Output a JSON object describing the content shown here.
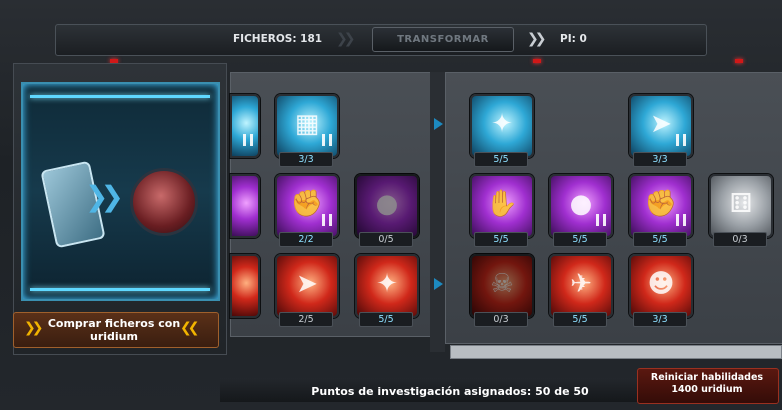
{
  "header": {
    "ficheros": "FICHEROS: 181",
    "transform_label": "TRANSFORMAR",
    "pi": "PI: 0"
  },
  "left_panel": {
    "buy_button": "Comprar ficheros con uridium"
  },
  "skills": [
    {
      "level": "",
      "color": "cyan"
    },
    {
      "level": "3/3",
      "color": "cyan"
    },
    {
      "level": "5/5",
      "color": "cyan"
    },
    {
      "level": "3/3",
      "color": "cyan"
    },
    {
      "level": "",
      "color": "purple"
    },
    {
      "level": "2/2",
      "color": "purple"
    },
    {
      "level": "0/5",
      "color": "purple"
    },
    {
      "level": "5/5",
      "color": "purple"
    },
    {
      "level": "5/5",
      "color": "purple"
    },
    {
      "level": "5/5",
      "color": "purple"
    },
    {
      "level": "0/3",
      "color": "grey"
    },
    {
      "level": "",
      "color": "red"
    },
    {
      "level": "2/5",
      "color": "red"
    },
    {
      "level": "5/5",
      "color": "red"
    },
    {
      "level": "0/3",
      "color": "red"
    },
    {
      "level": "5/5",
      "color": "red"
    },
    {
      "level": "3/3",
      "color": "red"
    }
  ],
  "footer": {
    "assigned_points": "Puntos de investigación asignados: 50 de 50",
    "reset_line1": "Reiniciar habilidades",
    "reset_line2": "1400 uridium"
  },
  "colors": {
    "cyan": "#2ea8d6",
    "purple": "#a02fd0",
    "red": "#d0281a",
    "orange_button": "#5a3018",
    "accent_arrow": "#f2b400"
  }
}
